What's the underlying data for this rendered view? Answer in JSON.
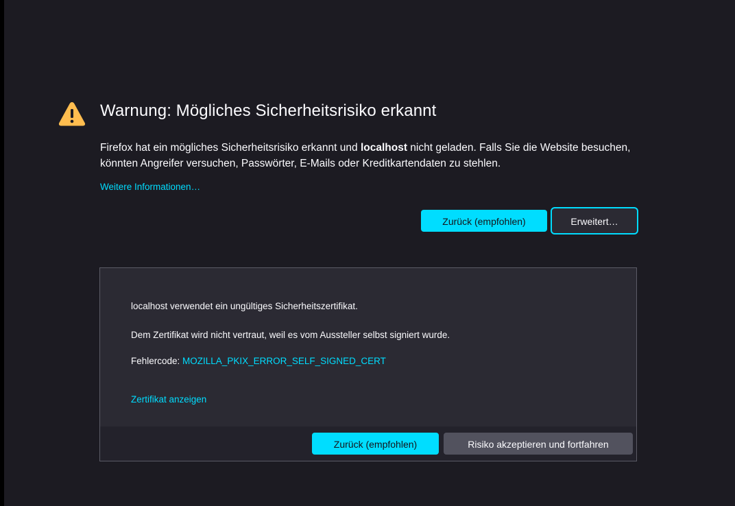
{
  "page": {
    "title": "Warnung: Mögliches Sicherheitsrisiko erkannt",
    "intro": {
      "before": "Firefox hat ein mögliches Sicherheitsrisiko erkannt und ",
      "host": "localhost",
      "after": " nicht geladen. Falls Sie die Website besuchen, könnten Angreifer versuchen, Passwörter, E-Mails oder Kreditkartendaten zu stehlen."
    },
    "learn_more": "Weitere Informationen…",
    "buttons": {
      "back": "Zurück (empfohlen)",
      "advanced": "Erweitert…"
    }
  },
  "advanced_panel": {
    "line1": "localhost verwendet ein ungültiges Sicherheitszertifikat.",
    "line2": "Dem Zertifikat wird nicht vertraut, weil es vom Aussteller selbst signiert wurde.",
    "error_label": "Fehlercode: ",
    "error_code": "MOZILLA_PKIX_ERROR_SELF_SIGNED_CERT",
    "view_certificate": "Zertifikat anzeigen",
    "buttons": {
      "back": "Zurück (empfohlen)",
      "accept": "Risiko akzeptieren und fortfahren"
    }
  },
  "colors": {
    "background": "#1c1b22",
    "panel": "#2b2a33",
    "accent": "#00ddff",
    "warning": "#ffbd4f"
  },
  "icons": {
    "warning": "warning-triangle-icon"
  }
}
